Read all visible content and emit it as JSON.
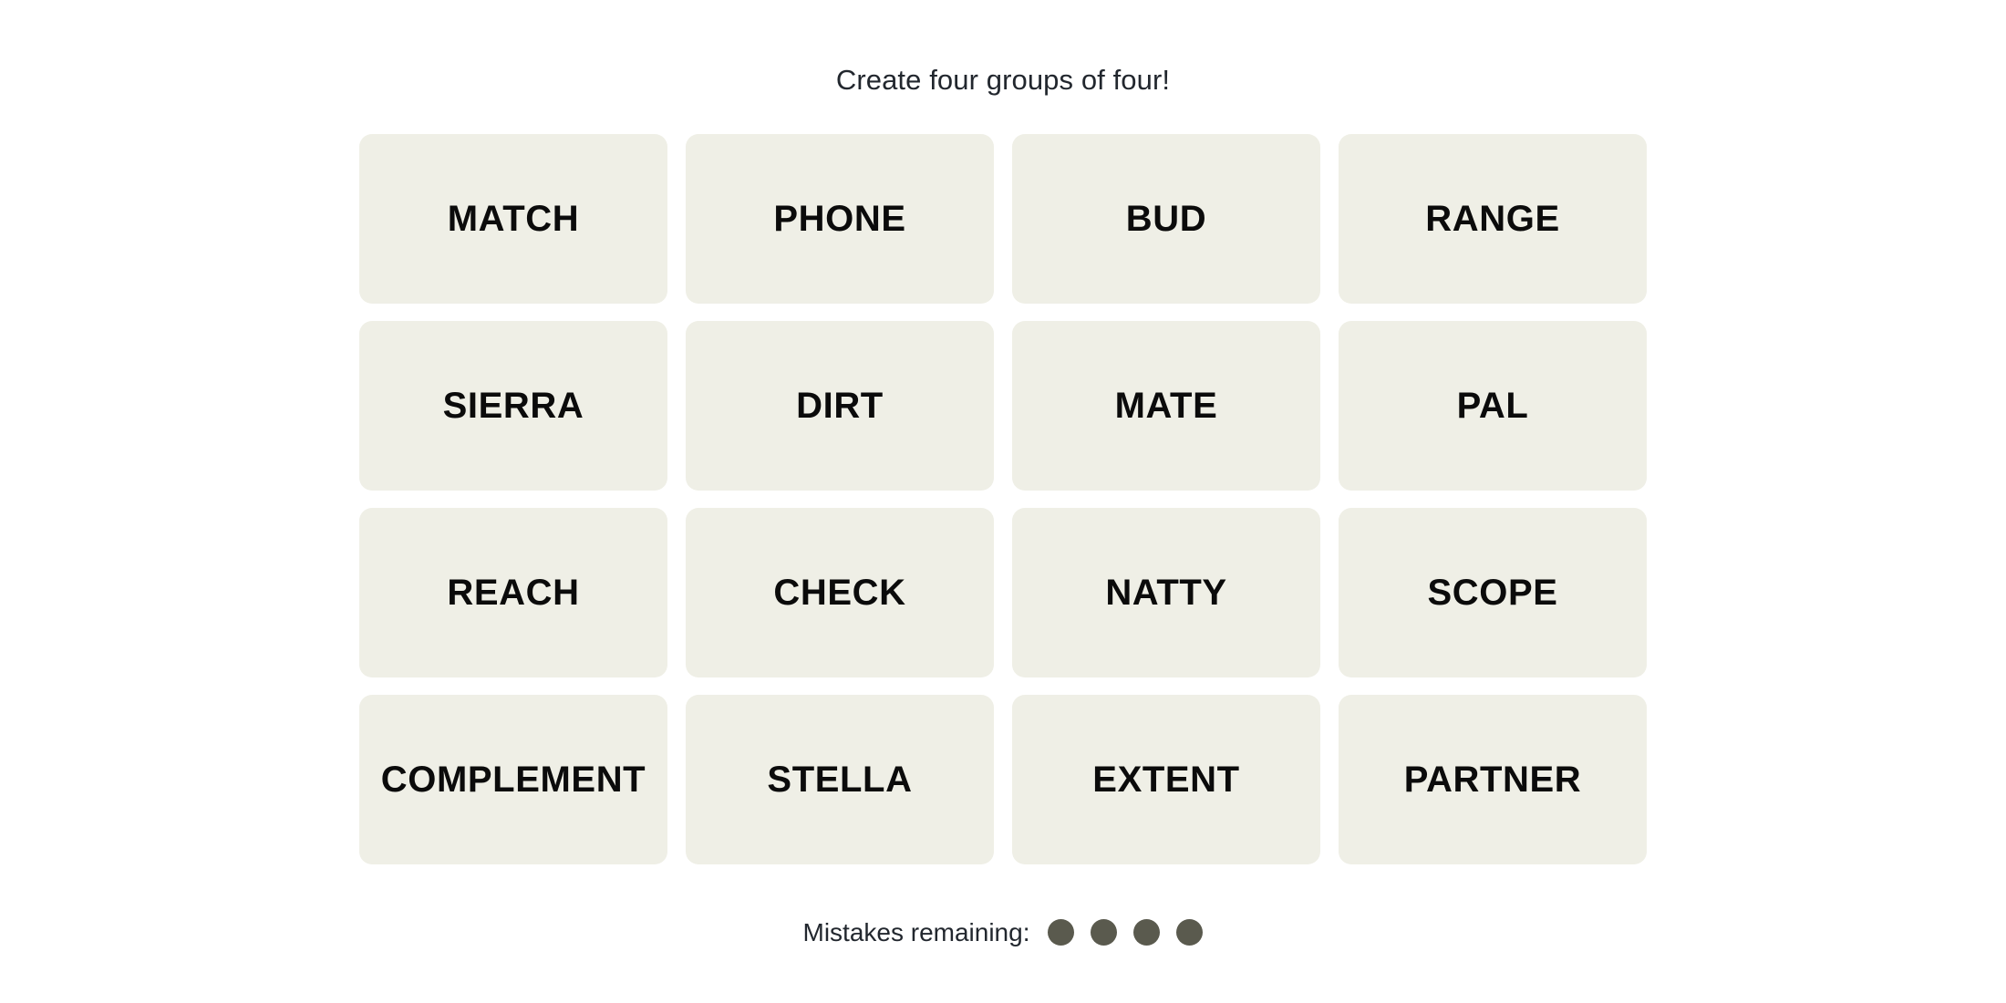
{
  "game": {
    "title": "Create four groups of four!",
    "tile_bg_color": "#EFEFE6",
    "tile_text_color": "#0B0B0B",
    "page_bg_color": "#FFFFFF",
    "dot_color": "#5A5A4E",
    "board": {
      "columns": 4,
      "rows": 4,
      "tiles": [
        {
          "label": "MATCH"
        },
        {
          "label": "PHONE"
        },
        {
          "label": "BUD"
        },
        {
          "label": "RANGE"
        },
        {
          "label": "SIERRA"
        },
        {
          "label": "DIRT"
        },
        {
          "label": "MATE"
        },
        {
          "label": "PAL"
        },
        {
          "label": "REACH"
        },
        {
          "label": "CHECK"
        },
        {
          "label": "NATTY"
        },
        {
          "label": "SCOPE"
        },
        {
          "label": "COMPLEMENT"
        },
        {
          "label": "STELLA"
        },
        {
          "label": "EXTENT"
        },
        {
          "label": "PARTNER"
        }
      ]
    },
    "mistakes": {
      "label": "Mistakes remaining:",
      "remaining": 4,
      "dots": [
        1,
        2,
        3,
        4
      ]
    }
  }
}
